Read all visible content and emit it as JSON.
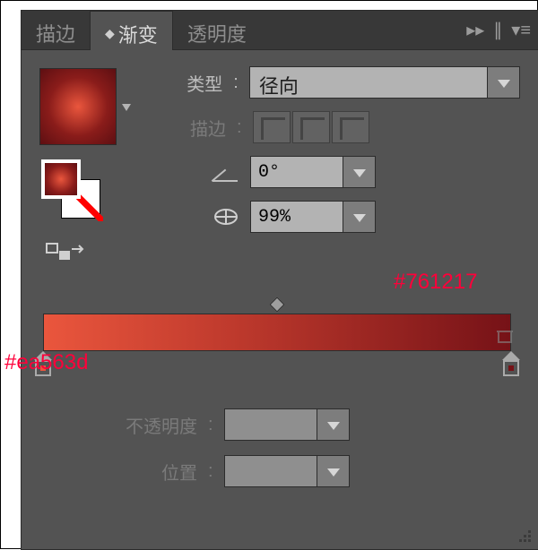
{
  "tabs": {
    "stroke": "描边",
    "gradient": "渐变",
    "transparency": "透明度"
  },
  "rows": {
    "type_label": "类型",
    "stroke_label": "描边",
    "type_value": "径向",
    "angle_value": "0°",
    "aspect_value": "99%",
    "opacity_label": "不透明度",
    "position_label": "位置"
  },
  "annotations": {
    "right_hex": "#761217",
    "left_hex": "#ea563d"
  },
  "gradient": {
    "start": "#ea563d",
    "end": "#761217"
  }
}
